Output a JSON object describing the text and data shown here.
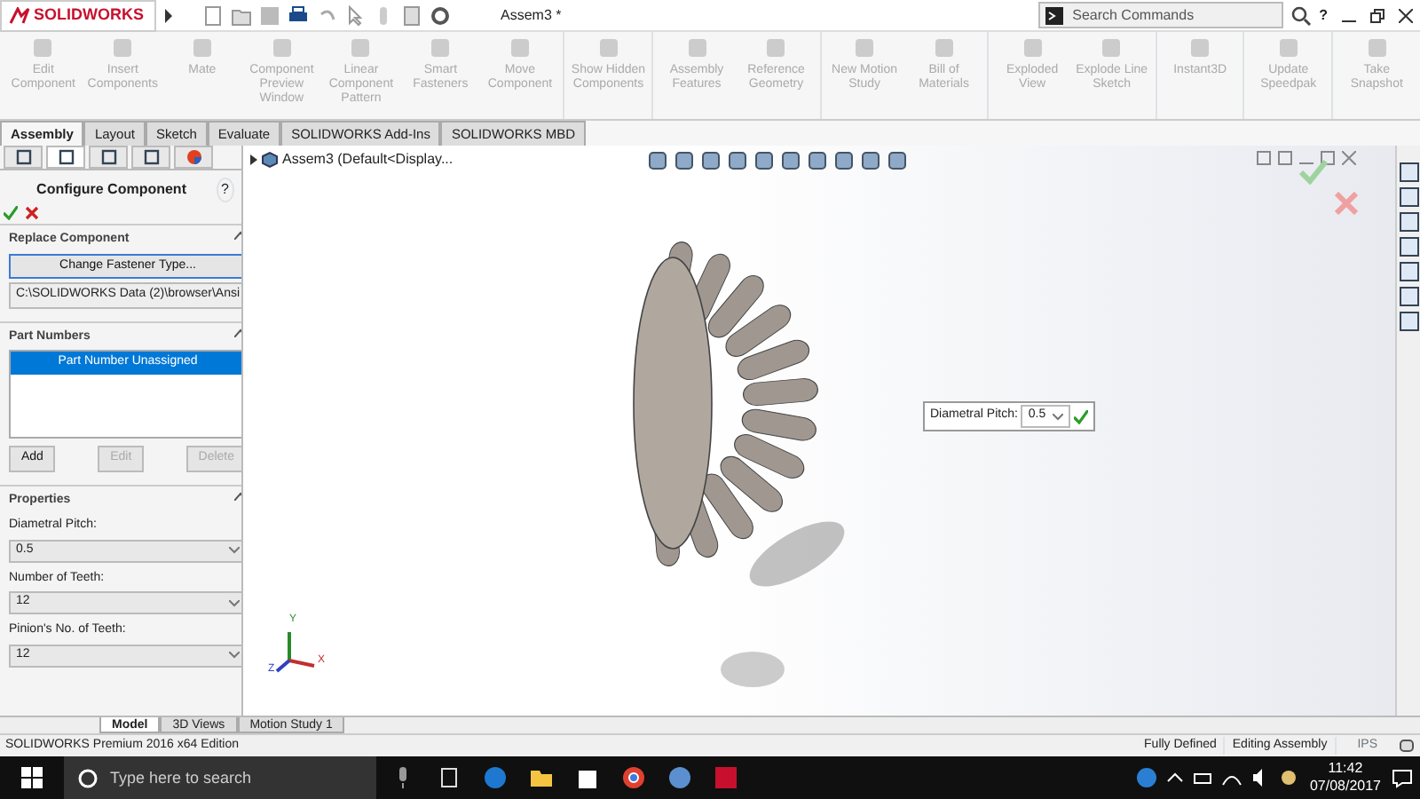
{
  "app": {
    "logo": "SOLIDWORKS",
    "document_title": "Assem3 *",
    "search": {
      "placeholder": "Search Commands"
    },
    "help": "?"
  },
  "ribbon": [
    {
      "label": "Edit Component",
      "disabled": true
    },
    {
      "label": "Insert Components",
      "disabled": true
    },
    {
      "label": "Mate",
      "disabled": true
    },
    {
      "label": "Component Preview Window",
      "disabled": true
    },
    {
      "label": "Linear Component Pattern",
      "disabled": true
    },
    {
      "label": "Smart Fasteners",
      "disabled": true
    },
    {
      "label": "Move Component",
      "disabled": true
    },
    {
      "label": "Show Hidden Components",
      "disabled": true
    },
    {
      "label": "Assembly Features",
      "disabled": true
    },
    {
      "label": "Reference Geometry",
      "disabled": true
    },
    {
      "label": "New Motion Study",
      "disabled": true
    },
    {
      "label": "Bill of Materials",
      "disabled": true
    },
    {
      "label": "Exploded View",
      "disabled": true
    },
    {
      "label": "Explode Line Sketch",
      "disabled": true
    },
    {
      "label": "Instant3D",
      "disabled": true
    },
    {
      "label": "Update Speedpak",
      "disabled": true
    },
    {
      "label": "Take Snapshot",
      "disabled": true
    }
  ],
  "tabs": [
    {
      "label": "Assembly",
      "selected": true
    },
    {
      "label": "Layout",
      "selected": false
    },
    {
      "label": "Sketch",
      "selected": false
    },
    {
      "label": "Evaluate",
      "selected": false
    },
    {
      "label": "SOLIDWORKS Add-Ins",
      "selected": false
    },
    {
      "label": "SOLIDWORKS MBD",
      "selected": false
    }
  ],
  "property_manager": {
    "title": "Configure Component",
    "help": "?",
    "replace_component": {
      "heading": "Replace Component",
      "button": "Change Fastener Type...",
      "path": "C:\\SOLIDWORKS Data (2)\\browser\\Ansi"
    },
    "part_numbers": {
      "heading": "Part Numbers",
      "items": [
        {
          "label": "Part Number Unassigned",
          "selected": true
        }
      ],
      "buttons": [
        {
          "label": "Add",
          "disabled": false
        },
        {
          "label": "Edit",
          "disabled": true
        },
        {
          "label": "Delete",
          "disabled": true
        }
      ]
    },
    "properties": {
      "heading": "Properties",
      "fields": [
        {
          "label": "Diametral Pitch:",
          "value": "0.5"
        },
        {
          "label": "Number of Teeth:",
          "value": "12"
        },
        {
          "label": "Pinion's No. of Teeth:",
          "value": "12"
        }
      ]
    }
  },
  "viewport": {
    "tree_item": "Assem3  (Default<Display...",
    "callout": {
      "label": "Diametral Pitch:",
      "value": "0.5"
    },
    "triad": {
      "x": "X",
      "y": "Y",
      "z": "Z"
    }
  },
  "bottom_tabs": [
    {
      "label": "Model",
      "selected": true
    },
    {
      "label": "3D Views",
      "selected": false
    },
    {
      "label": "Motion Study 1",
      "selected": false
    }
  ],
  "status_bar": {
    "edition": "SOLIDWORKS Premium 2016 x64 Edition",
    "state": "Fully Defined",
    "mode": "Editing Assembly",
    "units": "IPS"
  },
  "taskbar": {
    "search": {
      "placeholder": "Type here to search"
    },
    "time": "11:42",
    "date": "07/08/2017"
  }
}
